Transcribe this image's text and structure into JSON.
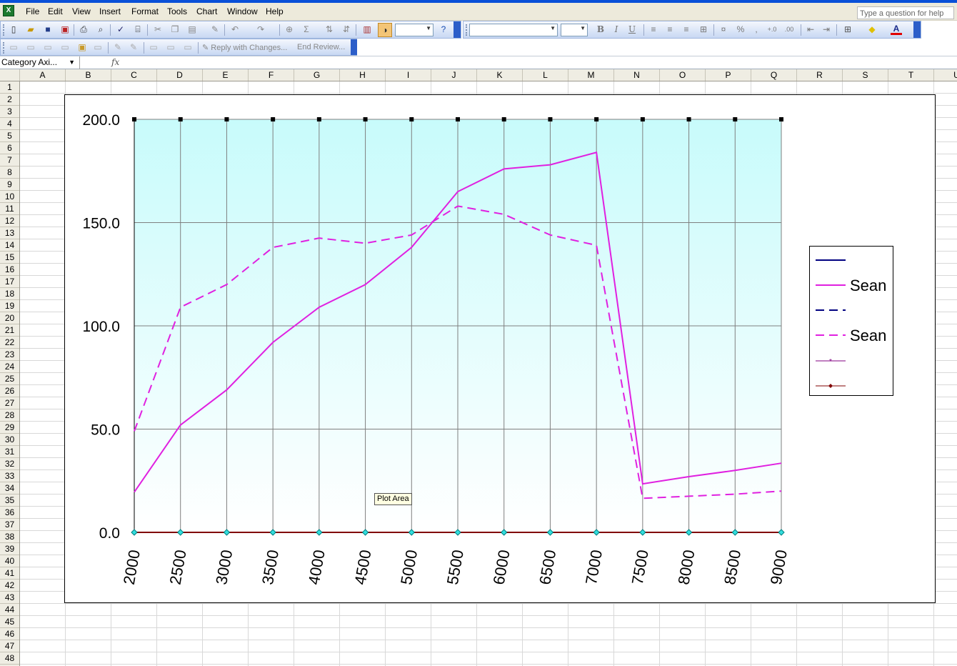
{
  "menu": {
    "items": [
      "File",
      "Edit",
      "View",
      "Insert",
      "Format",
      "Tools",
      "Chart",
      "Window",
      "Help"
    ],
    "ask_placeholder": "Type a question for help"
  },
  "toolbar": {
    "bold": "B",
    "italic": "I",
    "underline": "U",
    "percent": "%",
    "comma": ",",
    "reply_with_changes": "Reply with Changes...",
    "end_review": "End Review..."
  },
  "formula_bar": {
    "name_box": "Category Axi...",
    "fx": "fx"
  },
  "columns": [
    "A",
    "B",
    "C",
    "D",
    "E",
    "F",
    "G",
    "H",
    "I",
    "J",
    "K",
    "L",
    "M",
    "N",
    "O",
    "P",
    "Q",
    "R",
    "S",
    "T",
    "U"
  ],
  "rows": [
    "1",
    "2",
    "3",
    "4",
    "5",
    "6",
    "7",
    "8",
    "9",
    "10",
    "11",
    "12",
    "13",
    "14",
    "15",
    "16",
    "17",
    "18",
    "19",
    "20",
    "21",
    "22",
    "23",
    "24",
    "25",
    "26",
    "27",
    "28",
    "29",
    "30",
    "31",
    "32",
    "33",
    "34",
    "35",
    "36",
    "37",
    "38",
    "39",
    "40",
    "41",
    "42",
    "43",
    "44",
    "45",
    "46",
    "47",
    "48"
  ],
  "tooltip": "Plot Area",
  "colors": {
    "magenta": "#e020e0",
    "navy": "#000080",
    "plot_top": "#c8fbfb",
    "plot_bottom": "#ffffff",
    "gridline": "#7f7f7f"
  },
  "chart_data": {
    "type": "line",
    "categories": [
      "2000",
      "2500",
      "3000",
      "3500",
      "4000",
      "4500",
      "5000",
      "5500",
      "6000",
      "6500",
      "7000",
      "7500",
      "8000",
      "8500",
      "9000"
    ],
    "ylim": [
      0,
      200
    ],
    "yticks": [
      "0.0",
      "50.0",
      "100.0",
      "150.0",
      "200.0"
    ],
    "ytick_values": [
      0,
      50,
      100,
      150,
      200
    ],
    "grid": true,
    "legend_position": "right",
    "series": [
      {
        "name": "",
        "style": "solid",
        "color": "#000080",
        "values": [
          0,
          0,
          0,
          0,
          0,
          0,
          0,
          0,
          0,
          0,
          0,
          0,
          0,
          0,
          0
        ]
      },
      {
        "name": "Sean",
        "style": "solid",
        "color": "#e020e0",
        "values": [
          19.5,
          52,
          69,
          92,
          109,
          120,
          138,
          165,
          176,
          178,
          184,
          23.5,
          27,
          30,
          33.5
        ]
      },
      {
        "name": "",
        "style": "dashed",
        "color": "#000080",
        "values": [
          0,
          0,
          0,
          0,
          0,
          0,
          0,
          0,
          0,
          0,
          0,
          0,
          0,
          0,
          0
        ]
      },
      {
        "name": "Sean",
        "style": "dashed",
        "color": "#e020e0",
        "values": [
          49,
          109,
          120,
          138,
          142.5,
          140,
          144,
          158,
          154,
          144,
          139,
          16.5,
          17.5,
          18.5,
          20
        ]
      },
      {
        "name": "",
        "style": "marker-star",
        "color": "#800080",
        "values": [
          0,
          0,
          0,
          0,
          0,
          0,
          0,
          0,
          0,
          0,
          0,
          0,
          0,
          0,
          0
        ]
      },
      {
        "name": "",
        "style": "marker-diamond",
        "color": "#800000",
        "values": [
          0,
          0,
          0,
          0,
          0,
          0,
          0,
          0,
          0,
          0,
          0,
          0,
          0,
          0,
          0
        ]
      }
    ]
  }
}
